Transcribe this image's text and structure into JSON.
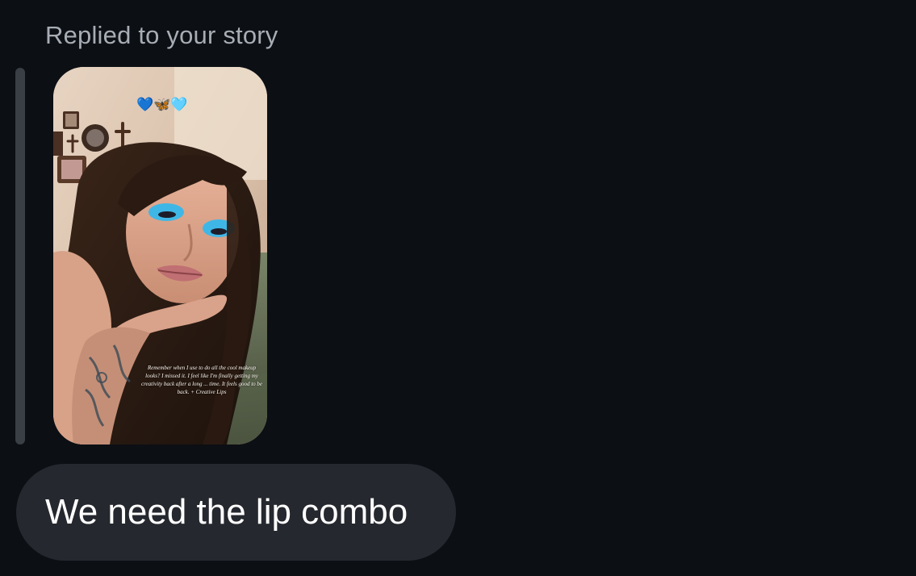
{
  "thread": {
    "reply_context": "Replied to your story",
    "story": {
      "sticker": "💙🦋🩵",
      "caption": "Remember when I use to do all the cool makeup looks? I missed it. I feel like I'm finally getting my creativity back after a long ... time. It feels good to be back. + Creative Lips"
    },
    "message": {
      "text": "We need the lip combo"
    }
  },
  "colors": {
    "background": "#0c0f14",
    "reply_context_text": "#a8adb5",
    "quote_bar": "#3a3e45",
    "bubble": "#25282e",
    "bubble_text": "#ffffff"
  }
}
